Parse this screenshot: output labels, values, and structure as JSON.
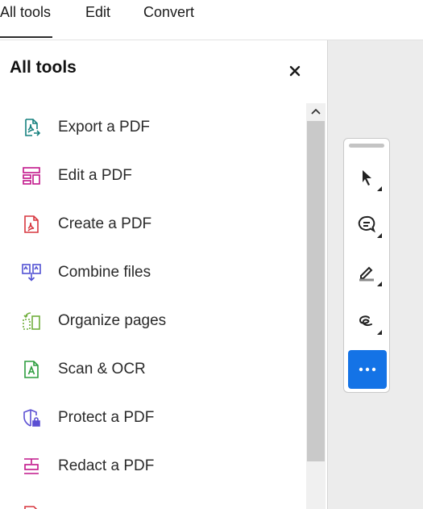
{
  "tabs": [
    {
      "label": "All tools",
      "active": true
    },
    {
      "label": "Edit",
      "active": false
    },
    {
      "label": "Convert",
      "active": false
    }
  ],
  "panel": {
    "title": "All tools",
    "close_icon": "close-icon"
  },
  "tools": [
    {
      "label": "Export a PDF",
      "icon": "export-pdf-icon",
      "color": "#17817f"
    },
    {
      "label": "Edit a PDF",
      "icon": "edit-pdf-icon",
      "color": "#c1168a"
    },
    {
      "label": "Create a PDF",
      "icon": "create-pdf-icon",
      "color": "#d7373f"
    },
    {
      "label": "Combine files",
      "icon": "combine-files-icon",
      "color": "#5151d3"
    },
    {
      "label": "Organize pages",
      "icon": "organize-pages-icon",
      "color": "#6fae3b"
    },
    {
      "label": "Scan & OCR",
      "icon": "scan-ocr-icon",
      "color": "#2d9d3f"
    },
    {
      "label": "Protect a PDF",
      "icon": "protect-pdf-icon",
      "color": "#5b4fd3"
    },
    {
      "label": "Redact a PDF",
      "icon": "redact-pdf-icon",
      "color": "#c1168a"
    }
  ],
  "quick_tools": [
    {
      "icon": "select-cursor-icon"
    },
    {
      "icon": "add-comment-icon"
    },
    {
      "icon": "highlight-pen-icon"
    },
    {
      "icon": "draw-freeform-icon"
    },
    {
      "icon": "more-options-icon"
    }
  ],
  "colors": {
    "accent": "#1473e6",
    "panel_bg": "#ffffff",
    "side_bg": "#ececec"
  }
}
